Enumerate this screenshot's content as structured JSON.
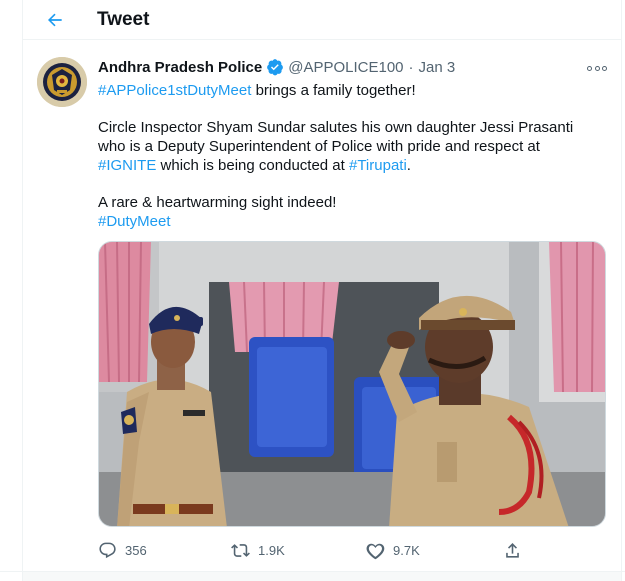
{
  "header": {
    "title": "Tweet",
    "back_icon": "arrow-left-icon"
  },
  "tweet": {
    "author_name": "Andhra Pradesh Police",
    "verified_icon": "verified-badge-icon",
    "handle": "@APPOLICE100",
    "separator": "·",
    "date": "Jan 3",
    "more_icon": "more-dots-icon",
    "line1": {
      "tag": "#APPolice1stDutyMeet",
      "rest": " brings a family together!"
    },
    "para2": {
      "l1": "Circle Inspector Shyam Sundar salutes his own daughter Jessi Prasanti",
      "l2": "who is a Deputy Superintendent of Police with pride and respect at",
      "l3_tag1": "#IGNITE",
      "l3_mid": " which is being conducted at ",
      "l3_tag2": "#Tirupati",
      "l3_end": "."
    },
    "para3": {
      "l1": "A rare & heartwarming sight indeed!",
      "tag": "#DutyMeet"
    },
    "actions": {
      "reply": {
        "icon": "reply-icon",
        "count": "356"
      },
      "retweet": {
        "icon": "retweet-icon",
        "count": "1.9K"
      },
      "like": {
        "icon": "heart-icon",
        "count": "9.7K"
      },
      "share": {
        "icon": "share-icon"
      }
    }
  },
  "colors": {
    "accent": "#1d9bf0",
    "text": "#0f1419",
    "secondary": "#536471",
    "border": "#eff3f4"
  }
}
